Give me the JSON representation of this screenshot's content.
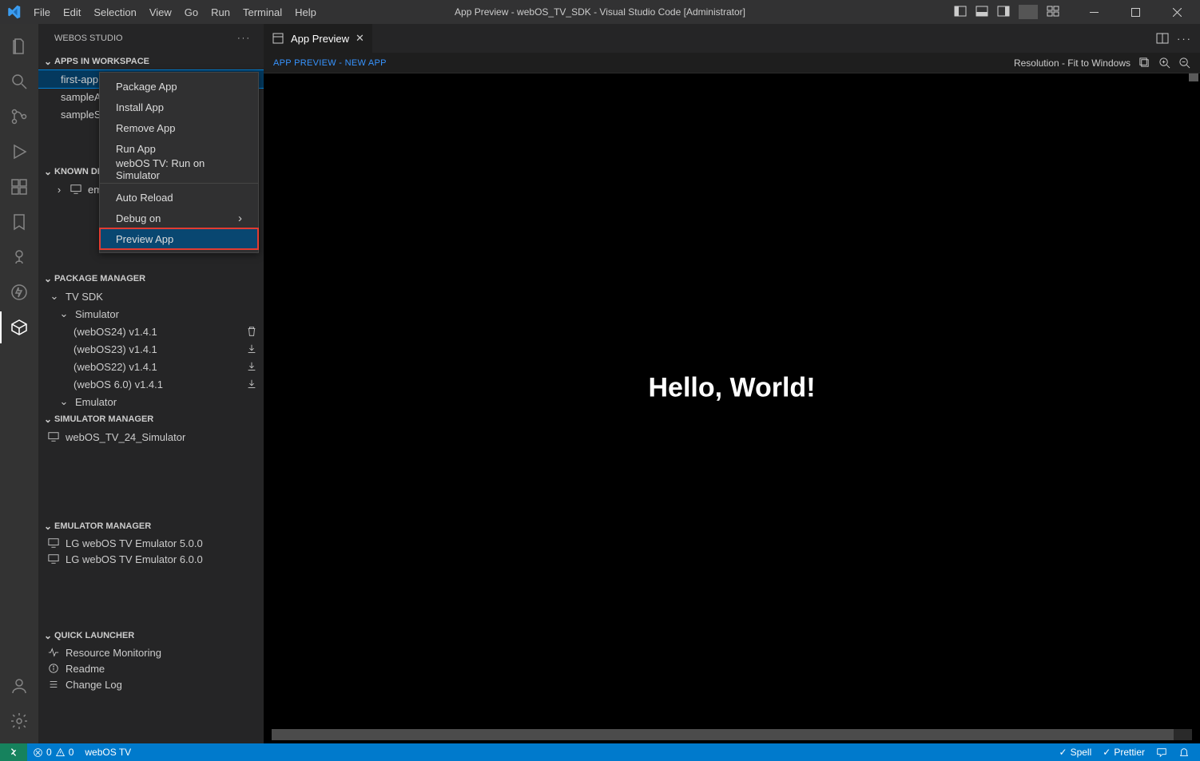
{
  "title": "App Preview - webOS_TV_SDK - Visual Studio Code [Administrator]",
  "menubar": [
    "File",
    "Edit",
    "Selection",
    "View",
    "Go",
    "Run",
    "Terminal",
    "Help"
  ],
  "sidebar": {
    "title": "WEBOS STUDIO",
    "apps": {
      "header": "APPS IN WORKSPACE",
      "items": [
        "first-app",
        "sampleA",
        "sampleS"
      ]
    },
    "devices": {
      "header": "KNOWN DEV",
      "items": [
        "emul"
      ]
    },
    "pkgmgr": {
      "header": "PACKAGE MANAGER",
      "tvsdk": "TV SDK",
      "sim": "Simulator",
      "versions": [
        "(webOS24) v1.4.1",
        "(webOS23) v1.4.1",
        "(webOS22) v1.4.1",
        "(webOS 6.0) v1.4.1"
      ],
      "emu": "Emulator"
    },
    "simmgr": {
      "header": "SIMULATOR MANAGER",
      "items": [
        "webOS_TV_24_Simulator"
      ]
    },
    "emumgr": {
      "header": "EMULATOR MANAGER",
      "items": [
        "LG webOS TV Emulator 5.0.0",
        "LG webOS TV Emulator 6.0.0"
      ]
    },
    "quick": {
      "header": "QUICK LAUNCHER",
      "items": [
        "Resource Monitoring",
        "Readme",
        "Change Log"
      ]
    }
  },
  "context_menu": {
    "items": [
      {
        "label": "Package App"
      },
      {
        "label": "Install App"
      },
      {
        "label": "Remove App"
      },
      {
        "label": "Run App"
      },
      {
        "label": "webOS TV: Run on Simulator"
      },
      {
        "sep": true
      },
      {
        "label": "Auto Reload"
      },
      {
        "label": "Debug on",
        "submenu": true
      },
      {
        "label": "Preview App",
        "highlight": true
      }
    ]
  },
  "editor": {
    "tab": "App Preview",
    "breadcrumb_left": "App Preview - new app",
    "breadcrumb_right": "Resolution - Fit to Windows",
    "preview_text": "Hello, World!"
  },
  "statusbar": {
    "errors": "0",
    "warnings": "0",
    "host": "webOS TV",
    "spell": "Spell",
    "prettier": "Prettier"
  }
}
